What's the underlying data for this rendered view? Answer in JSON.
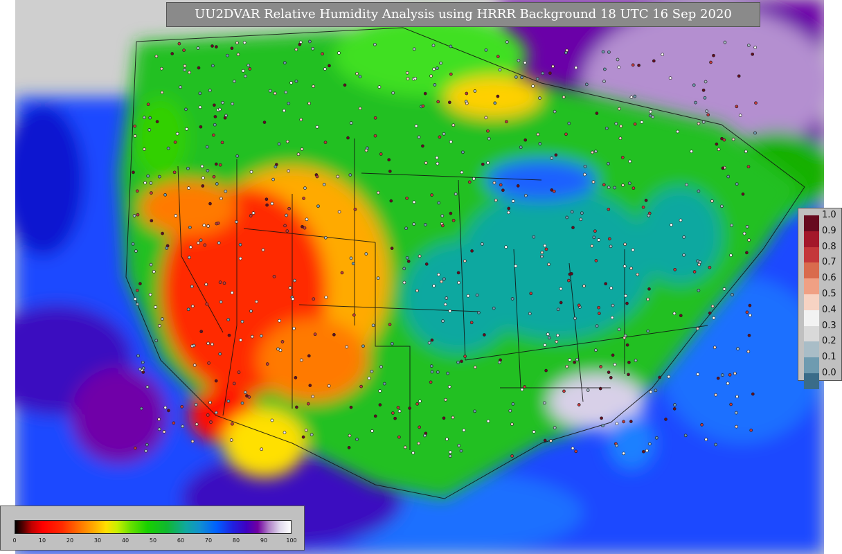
{
  "title": "UU2DVAR Relative Humidity Analysis using HRRR Background 18 UTC 16 Sep 2020",
  "ob_legend": {
    "labels": [
      "1.0",
      "0.9",
      "0.8",
      "0.7",
      "0.6",
      "0.5",
      "0.4",
      "0.3",
      "0.2",
      "0.1",
      "0.0"
    ],
    "colors": [
      "#670a1f",
      "#a3172a",
      "#c4373a",
      "#d96b4d",
      "#f0a084",
      "#f7d3c3",
      "#f2f2f2",
      "#d9d9d9",
      "#a9bdc7",
      "#6e9bb0",
      "#3a6c89",
      "#1c4a6a"
    ]
  },
  "rh_colorbar": {
    "ticks": [
      "0",
      "10",
      "20",
      "30",
      "40",
      "50",
      "60",
      "70",
      "80",
      "90",
      "100"
    ]
  },
  "colors": {
    "dry": "#ff1a00",
    "moist": "#18c000",
    "ocean": "#1a40ff",
    "saturated": "#7000a8",
    "background": "#cfcfcf"
  }
}
